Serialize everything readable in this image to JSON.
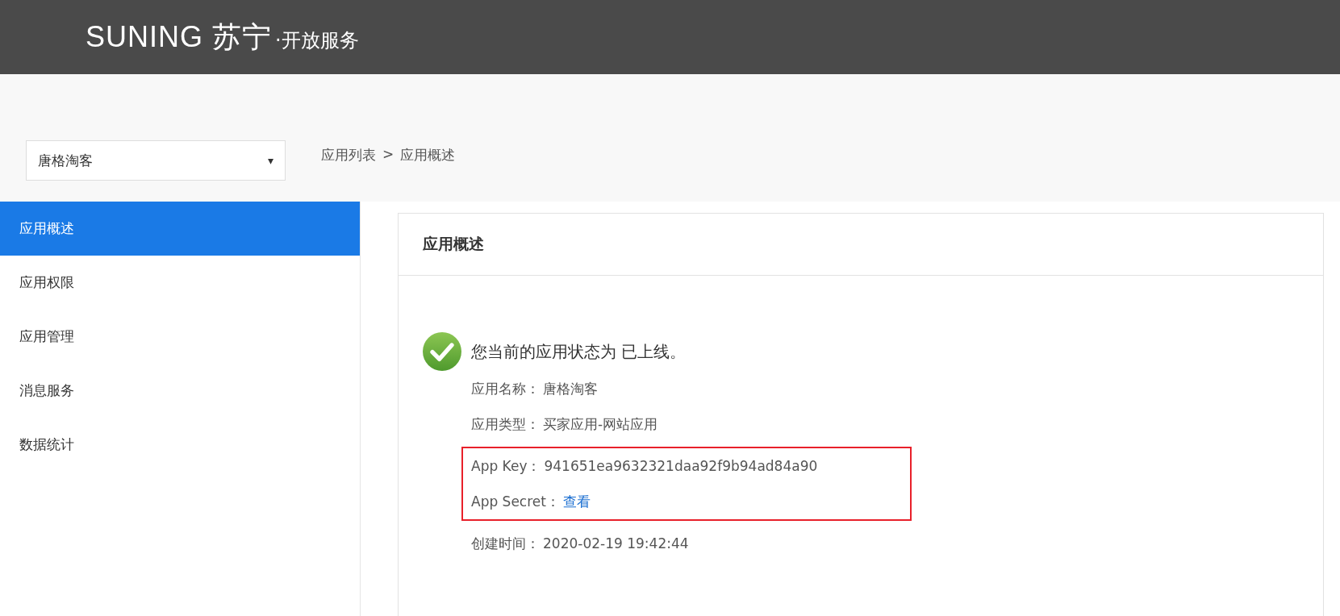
{
  "header": {
    "brand": "SUNING 苏宁",
    "suffix": "·开放服务"
  },
  "app_select": {
    "value": "唐格淘客",
    "caret": "▾"
  },
  "breadcrumb": [
    {
      "label": "应用列表"
    },
    {
      "label": ">"
    },
    {
      "label": "应用概述"
    }
  ],
  "sidebar": {
    "items": [
      {
        "label": "应用概述",
        "selected": true
      },
      {
        "label": "应用权限",
        "selected": false
      },
      {
        "label": "应用管理",
        "selected": false
      },
      {
        "label": "消息服务",
        "selected": false
      },
      {
        "label": "数据统计",
        "selected": false
      }
    ]
  },
  "panel": {
    "title": "应用概述",
    "status": "您当前的应用状态为 已上线。",
    "fields": [
      {
        "label": "应用名称：",
        "value": "唐格淘客",
        "kind": "text",
        "highlighted": false
      },
      {
        "label": "应用类型：",
        "value": "买家应用-网站应用",
        "kind": "text",
        "highlighted": false
      },
      {
        "label": "App Key：",
        "value": "941651ea9632321daa92f9b94ad84a90",
        "kind": "text",
        "highlighted": true
      },
      {
        "label": "App Secret：",
        "value": "查看",
        "kind": "link",
        "highlighted": true
      },
      {
        "label": "创建时间：",
        "value": "2020-02-19 19:42:44",
        "kind": "text",
        "highlighted": false
      }
    ]
  }
}
